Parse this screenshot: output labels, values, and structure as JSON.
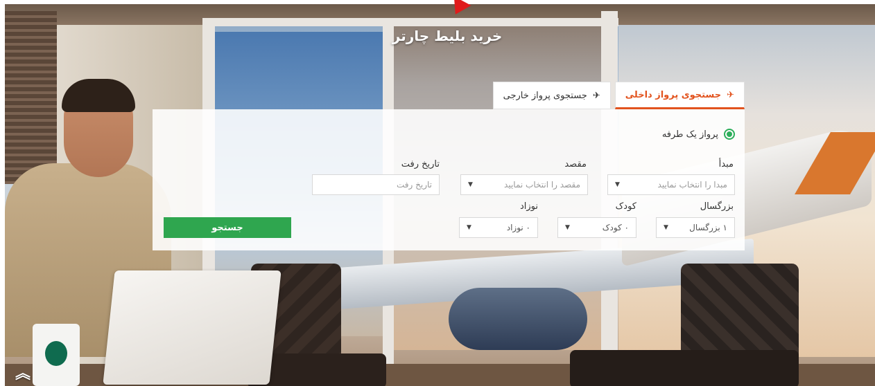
{
  "page": {
    "title": "خرید بلیط چارتر"
  },
  "tabs": [
    {
      "label": "جستجوی پرواز داخلی",
      "active": true,
      "icon": "plane-icon"
    },
    {
      "label": "جستجوی پرواز خارجی",
      "active": false,
      "icon": "plane-icon"
    }
  ],
  "form": {
    "trip_type": {
      "label": "پرواز یک طرفه",
      "selected": true
    },
    "origin": {
      "label": "مبدأ",
      "placeholder": "مبدا را انتخاب نمایید"
    },
    "destination": {
      "label": "مقصد",
      "placeholder": "مقصد را انتخاب نمایید"
    },
    "departure_date": {
      "label": "تاریخ رفت",
      "placeholder": "تاریخ رفت"
    },
    "adults": {
      "label": "بزرگسال",
      "value": "۱ بزرگسال"
    },
    "children": {
      "label": "کودک",
      "value": "۰ کودک"
    },
    "infants": {
      "label": "نوزاد",
      "value": "۰ نوزاد"
    },
    "search_label": "جستجو"
  },
  "colors": {
    "accent_tab": "#e2531e",
    "search_button": "#2fa64f",
    "radio": "#2cae5a"
  },
  "icons": {
    "dropdown": "caret-down-icon",
    "scroll_top": "double-chevron-up-icon"
  }
}
